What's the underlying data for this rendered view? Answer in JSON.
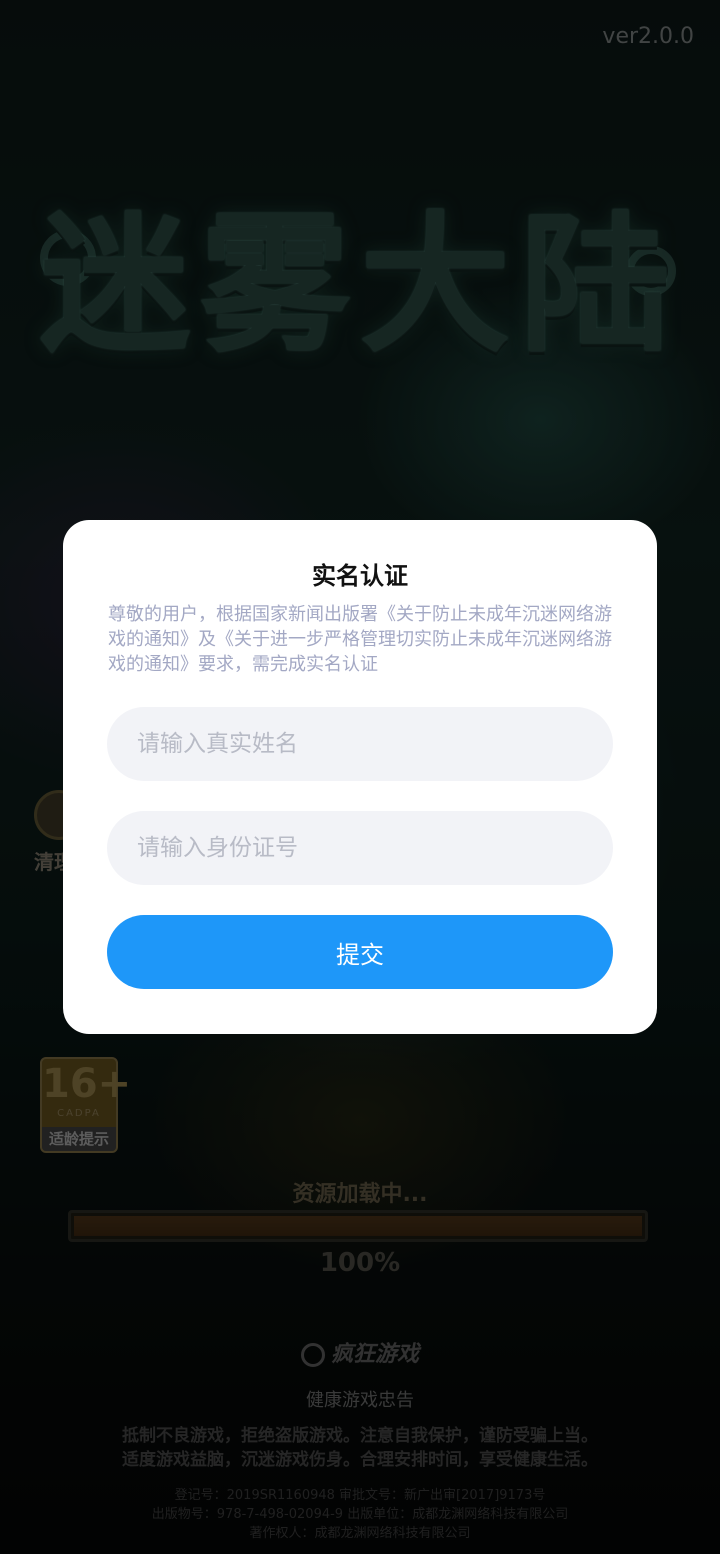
{
  "version": "ver2.0.0",
  "game_logo": "迷雾大陆",
  "side_button": {
    "label": "清理"
  },
  "age_rating": {
    "number": "16+",
    "org": "CADPA",
    "tip": "适龄提示"
  },
  "loading": {
    "label": "资源加载中...",
    "percent_text": "100%",
    "progress": 1.0
  },
  "publisher": "疯狂游戏",
  "advisory": {
    "title": "健康游戏忠告",
    "line1": "抵制不良游戏，拒绝盗版游戏。注意自我保护，谨防受骗上当。",
    "line2": "适度游戏益脑，沉迷游戏伤身。合理安排时间，享受健康生活。"
  },
  "legal": {
    "line1": "登记号：2019SR1160948   审批文号：新广出审[2017]9173号",
    "line2": "出版物号：978-7-498-02094-9   出版单位：成都龙渊网络科技有限公司",
    "line3": "著作权人：成都龙渊网络科技有限公司"
  },
  "modal": {
    "title": "实名认证",
    "notice": "尊敬的用户，根据国家新闻出版署《关于防止未成年沉迷网络游戏的通知》及《关于进一步严格管理切实防止未成年沉迷网络游戏的通知》要求，需完成实名认证",
    "name_field": {
      "placeholder": "请输入真实姓名",
      "value": ""
    },
    "id_field": {
      "placeholder": "请输入身份证号",
      "value": ""
    },
    "submit_label": "提交"
  },
  "colors": {
    "accent": "#1e97f9",
    "modal_background": "#ffffff",
    "notice_text": "#a3a8c4",
    "field_background": "#f2f3f7"
  }
}
